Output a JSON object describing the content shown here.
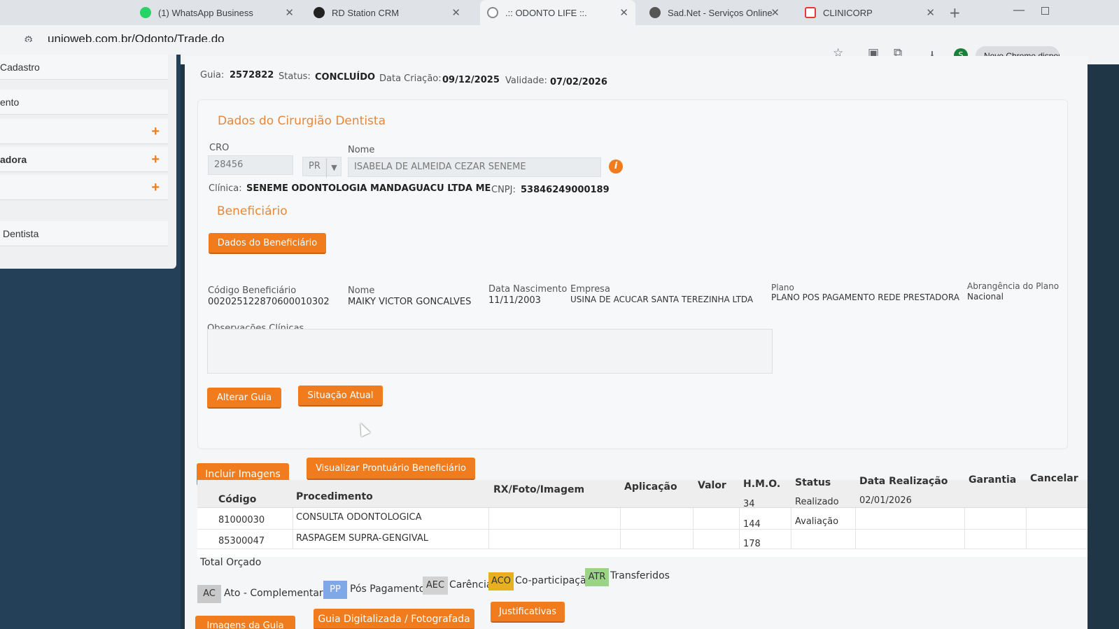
{
  "browser": {
    "tabs": [
      {
        "title": "(1) WhatsApp Business",
        "favicon_color": "#25D366"
      },
      {
        "title": "RD Station CRM",
        "favicon_color": "#222222"
      },
      {
        "title": ".:: ODONTO LIFE ::.",
        "favicon_color": "#888888"
      },
      {
        "title": "Sad.Net - Serviços Online",
        "favicon_color": "#555555"
      },
      {
        "title": "CLINICORP",
        "favicon_color": "#E53935"
      }
    ],
    "url": "unioweb.com.br/Odonto/Trade.do",
    "update_chip": "Novo Chrome dispon",
    "profile_initial": "S",
    "icons": [
      "site-info-icon",
      "star-icon",
      "translate-icon",
      "extensions-icon",
      "download-icon"
    ]
  },
  "sidebar": {
    "items": [
      {
        "label": "Cadastro",
        "plus": false
      },
      {
        "label": "ento",
        "plus": false
      },
      {
        "label": "",
        "plus": true
      },
      {
        "label": "adora",
        "plus": true
      },
      {
        "label": "",
        "plus": true
      },
      {
        "label": "Dentista",
        "plus": false
      }
    ]
  },
  "guia": {
    "guia_label": "Guia:",
    "guia_value": "2572822",
    "status_label": "Status:",
    "status_value": "CONCLUÍDO",
    "criacao_label": "Data Criação:",
    "criacao_value": "09/12/2025",
    "validade_label": "Validade:",
    "validade_value": "07/02/2026"
  },
  "dentista": {
    "section_title": "Dados do Cirurgião Dentista",
    "cro_label": "CRO",
    "cro_value": "28456",
    "uf_value": "PR",
    "nome_label": "Nome",
    "nome_value": "ISABELA DE ALMEIDA CEZAR SENEME",
    "clinica_label": "Clínica:",
    "clinica_value": "SENEME ODONTOLOGIA MANDAGUACU LTDA ME",
    "cnpj_label": "CNPJ:",
    "cnpj_value": "53846249000189"
  },
  "beneficiario": {
    "section_title": "Beneficiário",
    "dados_button": "Dados do Beneficiário",
    "codigo_label": "Código Beneficiário",
    "codigo_value": "002025122870600010302",
    "nome_label": "Nome",
    "nome_value": "MAIKY VICTOR GONCALVES",
    "nascimento_label": "Data Nascimento",
    "nascimento_value": "11/11/2003",
    "empresa_label": "Empresa",
    "empresa_value": "USINA DE ACUCAR SANTA TEREZINHA LTDA",
    "plano_label": "Plano",
    "plano_value": "PLANO POS PAGAMENTO REDE PRESTADORA",
    "abrangencia_label": "Abrangência do Plano",
    "abrangencia_value": "Nacional",
    "observacoes_label": "Observações Clínicas",
    "observacoes_value": ""
  },
  "actions": {
    "alterar_guia": "Alterar Guia",
    "situacao_atual": "Situação Atual",
    "incluir_imagens": "Incluir Imagens",
    "visualizar_prontuario": "Visualizar Prontuário Beneficiário",
    "imagens_guia": "Imagens da Guia",
    "guia_digitalizada": "Guia Digitalizada / Fotografada",
    "justificativas": "Justificativas"
  },
  "procedimentos": {
    "headers": [
      "Código",
      "Procedimento",
      "RX/Foto/Imagem",
      "Aplicação",
      "Valor",
      "H.M.O.",
      "Status",
      "Data Realização",
      "Garantia",
      "Cancelar"
    ],
    "rows": [
      {
        "codigo": "81000030",
        "procedimento": "CONSULTA ODONTOLOGICA",
        "rx": "",
        "aplicacao": "",
        "valor": "",
        "hmo": "34",
        "status": "Realizado",
        "data": "02/01/2026",
        "garantia": "",
        "cancelar": ""
      },
      {
        "codigo": "85300047",
        "procedimento": "RASPAGEM SUPRA-GENGIVAL",
        "rx": "",
        "aplicacao": "",
        "valor": "",
        "hmo": "144",
        "status": "Avaliação",
        "data": "",
        "garantia": "",
        "cancelar": ""
      },
      {
        "codigo": "",
        "procedimento": "",
        "rx": "",
        "aplicacao": "",
        "valor": "",
        "hmo": "178",
        "status": "",
        "data": "",
        "garantia": "",
        "cancelar": ""
      }
    ],
    "total_label": "Total Orçado"
  },
  "legend": [
    {
      "tag": "AC",
      "label": "Ato - Complementar",
      "color": "#c9c9c9"
    },
    {
      "tag": "PP",
      "label": "Pós Pagamento",
      "color": "#7fa8e6"
    },
    {
      "tag": "AEC",
      "label": "Carência",
      "color": "#d2d2d2"
    },
    {
      "tag": "ACO",
      "label": "Co-participação",
      "color": "#e8b020"
    },
    {
      "tag": "ATR",
      "label": "Transferidos",
      "color": "#9bd389"
    }
  ]
}
